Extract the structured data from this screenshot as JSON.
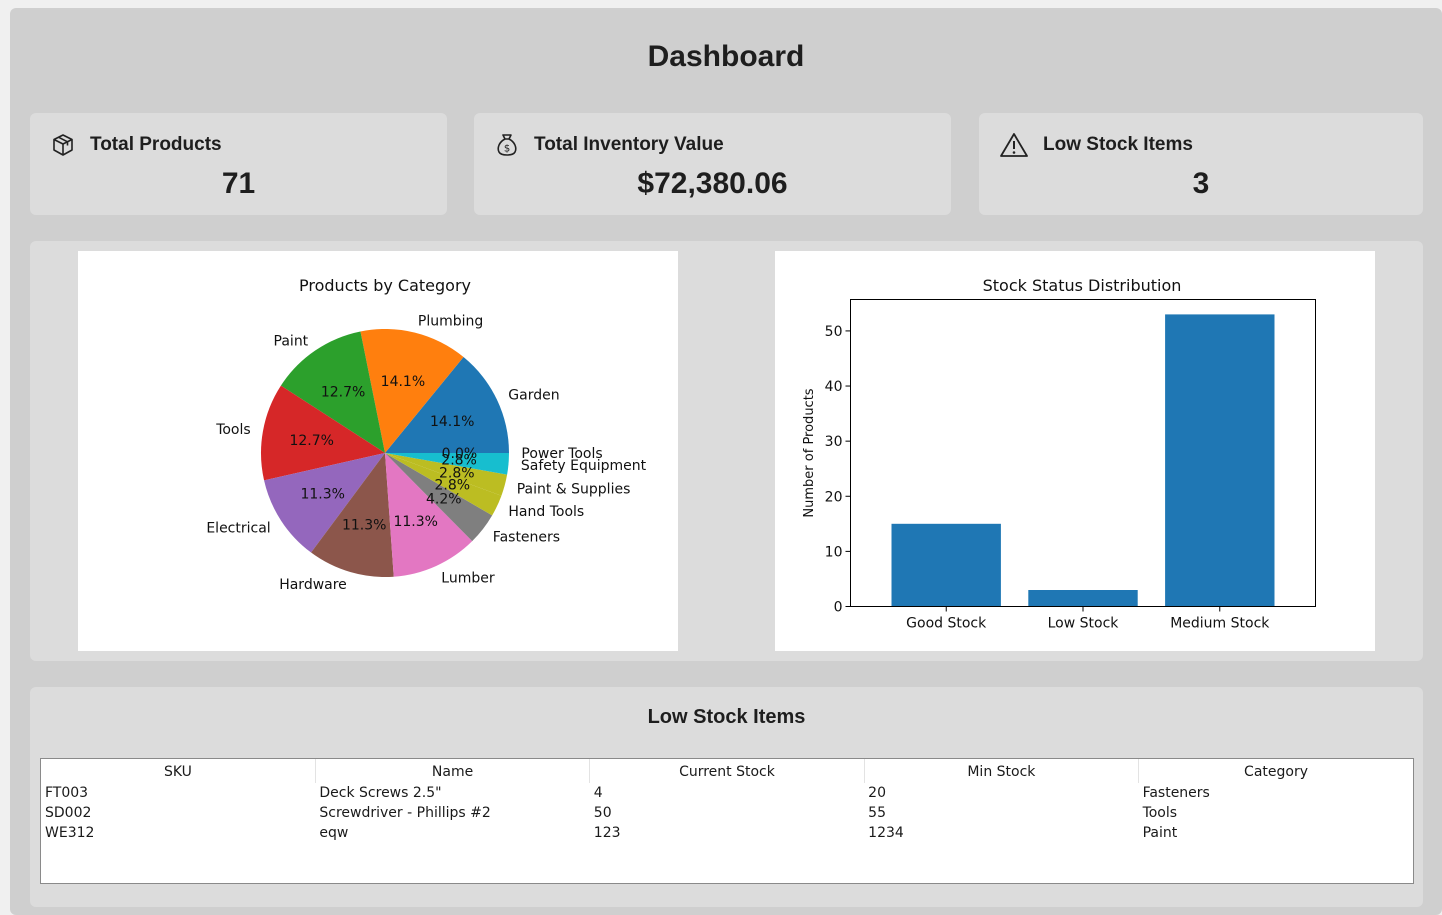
{
  "title": "Dashboard",
  "cards": [
    {
      "label": "Total Products",
      "value": "71",
      "icon": "box-icon"
    },
    {
      "label": "Total Inventory Value",
      "value": "$72,380.06",
      "icon": "money-bag-icon"
    },
    {
      "label": "Low Stock Items",
      "value": "3",
      "icon": "warning-icon"
    }
  ],
  "pie_chart": {
    "chart_data": {
      "type": "pie",
      "title": "Products by Category",
      "slices": [
        {
          "label": "Garden",
          "percent": 14.1,
          "pct_label": "14.1%",
          "color": "#1f77b4"
        },
        {
          "label": "Plumbing",
          "percent": 14.1,
          "pct_label": "14.1%",
          "color": "#ff7f0e"
        },
        {
          "label": "Paint",
          "percent": 12.7,
          "pct_label": "12.7%",
          "color": "#2ca02c"
        },
        {
          "label": "Tools",
          "percent": 12.7,
          "pct_label": "12.7%",
          "color": "#d62728"
        },
        {
          "label": "Electrical",
          "percent": 11.3,
          "pct_label": "11.3%",
          "color": "#9467bd"
        },
        {
          "label": "Hardware",
          "percent": 11.3,
          "pct_label": "11.3%",
          "color": "#8c564b"
        },
        {
          "label": "Lumber",
          "percent": 11.3,
          "pct_label": "11.3%",
          "color": "#e377c2"
        },
        {
          "label": "Fasteners",
          "percent": 4.2,
          "pct_label": "4.2%",
          "color": "#7f7f7f"
        },
        {
          "label": "Hand Tools",
          "percent": 2.8,
          "pct_label": "2.8%",
          "color": "#bcbd22"
        },
        {
          "label": "Paint & Supplies",
          "percent": 2.8,
          "pct_label": "2.8%",
          "color": "#bcbd22"
        },
        {
          "label": "Safety Equipment",
          "percent": 2.8,
          "pct_label": "2.8%",
          "color": "#17becf"
        },
        {
          "label": "Power Tools",
          "percent": 0.0,
          "pct_label": "0.0%",
          "color": "#1f77b4"
        }
      ]
    }
  },
  "bar_chart": {
    "chart_data": {
      "type": "bar",
      "title": "Stock Status Distribution",
      "categories": [
        "Good Stock",
        "Low Stock",
        "Medium Stock"
      ],
      "values": [
        15,
        3,
        53
      ],
      "ylabel": "Number of Products",
      "xlabel": "",
      "ylim": [
        0,
        55.7
      ],
      "yticks": [
        0,
        10,
        20,
        30,
        40,
        50
      ],
      "color": "#1f77b4"
    }
  },
  "low_stock_table": {
    "title": "Low Stock Items",
    "columns": [
      "SKU",
      "Name",
      "Current Stock",
      "Min Stock",
      "Category"
    ],
    "rows": [
      [
        "FT003",
        "Deck Screws 2.5\"",
        "4",
        "20",
        "Fasteners"
      ],
      [
        "SD002",
        "Screwdriver - Phillips #2",
        "50",
        "55",
        "Tools"
      ],
      [
        "WE312",
        "eqw",
        "123",
        "1234",
        "Paint"
      ]
    ]
  }
}
